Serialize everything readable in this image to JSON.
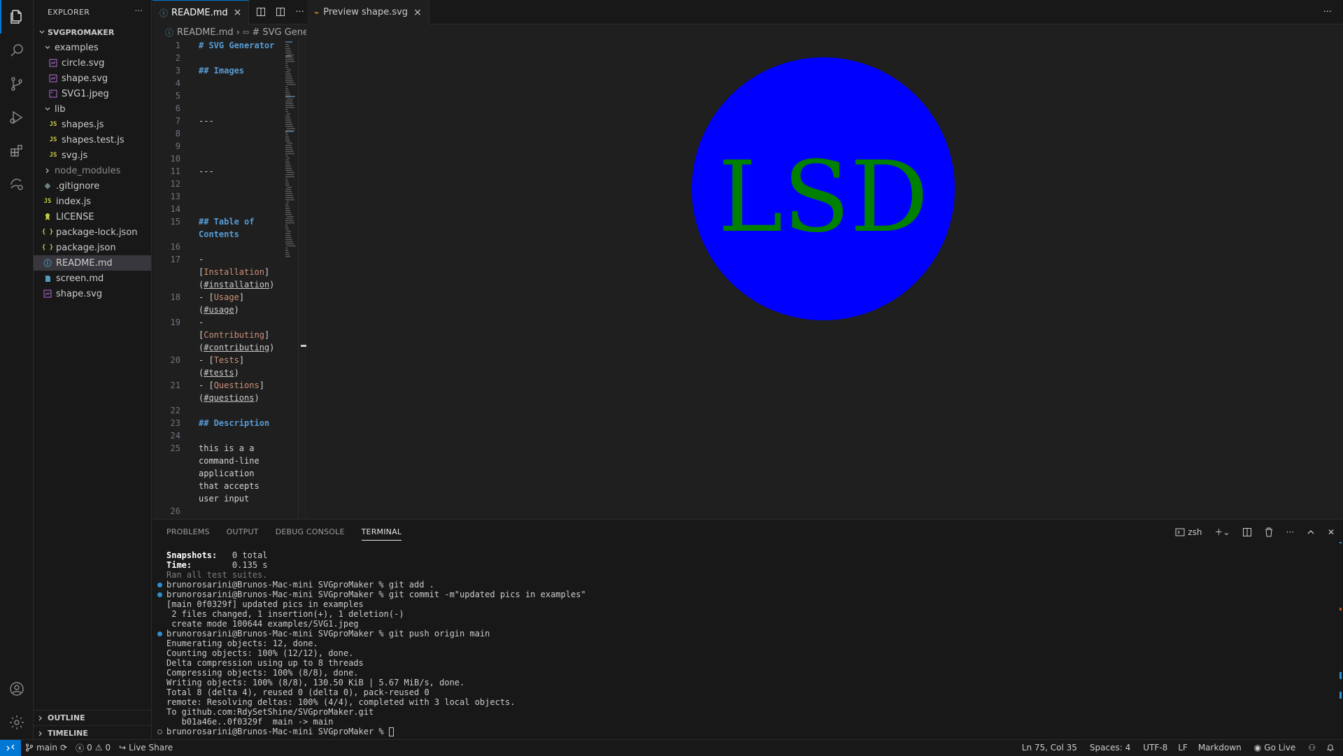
{
  "sidebar": {
    "title": "EXPLORER",
    "project": "SVGPROMAKER",
    "tree": [
      {
        "label": "examples",
        "type": "folder-open",
        "indent": 1
      },
      {
        "label": "circle.svg",
        "type": "svg",
        "indent": 2
      },
      {
        "label": "shape.svg",
        "type": "svg",
        "indent": 2
      },
      {
        "label": "SVG1.jpeg",
        "type": "image",
        "indent": 2
      },
      {
        "label": "lib",
        "type": "folder-open",
        "indent": 1
      },
      {
        "label": "shapes.js",
        "type": "js",
        "indent": 2
      },
      {
        "label": "shapes.test.js",
        "type": "js",
        "indent": 2
      },
      {
        "label": "svg.js",
        "type": "js",
        "indent": 2
      },
      {
        "label": "node_modules",
        "type": "folder-closed",
        "indent": 1
      },
      {
        "label": ".gitignore",
        "type": "git",
        "indent": 1
      },
      {
        "label": "index.js",
        "type": "js",
        "indent": 1
      },
      {
        "label": "LICENSE",
        "type": "license",
        "indent": 1
      },
      {
        "label": "package-lock.json",
        "type": "json",
        "indent": 1
      },
      {
        "label": "package.json",
        "type": "json",
        "indent": 1
      },
      {
        "label": "README.md",
        "type": "info",
        "indent": 1,
        "selected": true
      },
      {
        "label": "screen.md",
        "type": "md",
        "indent": 1
      },
      {
        "label": "shape.svg",
        "type": "svg",
        "indent": 1
      }
    ],
    "outline": "OUTLINE",
    "timeline": "TIMELINE"
  },
  "editor1": {
    "tab_label": "README.md",
    "breadcrumb_file": "README.md",
    "breadcrumb_symbol": "# SVG Gene",
    "lines": [
      {
        "n": "1",
        "segs": [
          {
            "t": "# SVG Generator",
            "c": "md-h"
          }
        ]
      },
      {
        "n": "2",
        "segs": []
      },
      {
        "n": "3",
        "segs": [
          {
            "t": "## Images",
            "c": "md-h"
          }
        ]
      },
      {
        "n": "4",
        "segs": []
      },
      {
        "n": "5",
        "segs": []
      },
      {
        "n": "6",
        "segs": []
      },
      {
        "n": "7",
        "segs": [
          {
            "t": "---",
            "c": "md-plain"
          }
        ]
      },
      {
        "n": "8",
        "segs": []
      },
      {
        "n": "9",
        "segs": []
      },
      {
        "n": "10",
        "segs": []
      },
      {
        "n": "11",
        "segs": [
          {
            "t": "---",
            "c": "md-plain"
          }
        ]
      },
      {
        "n": "12",
        "segs": []
      },
      {
        "n": "13",
        "segs": []
      },
      {
        "n": "14",
        "segs": []
      },
      {
        "n": "15",
        "segs": [
          {
            "t": "## Table of\nContents",
            "c": "md-h"
          }
        ]
      },
      {
        "n": "16",
        "segs": []
      },
      {
        "n": "17",
        "segs": [
          {
            "t": "-\n[",
            "c": "md-plain"
          },
          {
            "t": "Installation",
            "c": "md-link"
          },
          {
            "t": "]\n(",
            "c": "md-plain"
          },
          {
            "t": "#installation",
            "c": "md-url"
          },
          {
            "t": ")",
            "c": "md-plain"
          }
        ]
      },
      {
        "n": "18",
        "segs": [
          {
            "t": "- [",
            "c": "md-plain"
          },
          {
            "t": "Usage",
            "c": "md-link"
          },
          {
            "t": "]\n(",
            "c": "md-plain"
          },
          {
            "t": "#usage",
            "c": "md-url"
          },
          {
            "t": ")",
            "c": "md-plain"
          }
        ]
      },
      {
        "n": "19",
        "segs": [
          {
            "t": "-\n[",
            "c": "md-plain"
          },
          {
            "t": "Contributing",
            "c": "md-link"
          },
          {
            "t": "]\n(",
            "c": "md-plain"
          },
          {
            "t": "#contributing",
            "c": "md-url"
          },
          {
            "t": ")",
            "c": "md-plain"
          }
        ]
      },
      {
        "n": "20",
        "segs": [
          {
            "t": "- [",
            "c": "md-plain"
          },
          {
            "t": "Tests",
            "c": "md-link"
          },
          {
            "t": "]\n(",
            "c": "md-plain"
          },
          {
            "t": "#tests",
            "c": "md-url"
          },
          {
            "t": ")",
            "c": "md-plain"
          }
        ]
      },
      {
        "n": "21",
        "segs": [
          {
            "t": "- [",
            "c": "md-plain"
          },
          {
            "t": "Questions",
            "c": "md-link"
          },
          {
            "t": "]\n(",
            "c": "md-plain"
          },
          {
            "t": "#questions",
            "c": "md-url"
          },
          {
            "t": ")",
            "c": "md-plain"
          }
        ]
      },
      {
        "n": "22",
        "segs": []
      },
      {
        "n": "23",
        "segs": [
          {
            "t": "## Description",
            "c": "md-h"
          }
        ]
      },
      {
        "n": "24",
        "segs": []
      },
      {
        "n": "25",
        "segs": [
          {
            "t": "this is a a\ncommand-line\napplication\nthat accepts\nuser input",
            "c": "md-plain"
          }
        ]
      },
      {
        "n": "26",
        "segs": []
      }
    ]
  },
  "editor2": {
    "tab_label": "Preview shape.svg",
    "svg_text": "LSD",
    "circle_color": "#0000ff",
    "text_color": "#008000"
  },
  "panel": {
    "tabs": [
      "PROBLEMS",
      "OUTPUT",
      "DEBUG CONSOLE",
      "TERMINAL"
    ],
    "shell": "zsh",
    "terminal_lines": [
      {
        "text": "Snapshots:   0 total",
        "bold_prefix": "Snapshots:",
        "dot": ""
      },
      {
        "text": "Time:        0.135 s",
        "bold_prefix": "Time:",
        "dot": ""
      },
      {
        "text": "Ran all test suites.",
        "dim": true,
        "dot": ""
      },
      {
        "text": "brunorosarini@Brunos-Mac-mini SVGproMaker % git add .",
        "dot": "blue"
      },
      {
        "text": "brunorosarini@Brunos-Mac-mini SVGproMaker % git commit -m\"updated pics in examples\"",
        "dot": "blue"
      },
      {
        "text": "[main 0f0329f] updated pics in examples",
        "dot": ""
      },
      {
        "text": " 2 files changed, 1 insertion(+), 1 deletion(-)",
        "dot": ""
      },
      {
        "text": " create mode 100644 examples/SVG1.jpeg",
        "dot": ""
      },
      {
        "text": "brunorosarini@Brunos-Mac-mini SVGproMaker % git push origin main",
        "dot": "blue"
      },
      {
        "text": "Enumerating objects: 12, done.",
        "dot": ""
      },
      {
        "text": "Counting objects: 100% (12/12), done.",
        "dot": ""
      },
      {
        "text": "Delta compression using up to 8 threads",
        "dot": ""
      },
      {
        "text": "Compressing objects: 100% (8/8), done.",
        "dot": ""
      },
      {
        "text": "Writing objects: 100% (8/8), 130.50 KiB | 5.67 MiB/s, done.",
        "dot": ""
      },
      {
        "text": "Total 8 (delta 4), reused 0 (delta 0), pack-reused 0",
        "dot": ""
      },
      {
        "text": "remote: Resolving deltas: 100% (4/4), completed with 3 local objects.",
        "dot": ""
      },
      {
        "text": "To github.com:RdySetShine/SVGproMaker.git",
        "dot": ""
      },
      {
        "text": "   b01a46e..0f0329f  main -> main",
        "dot": ""
      },
      {
        "text": "brunorosarini@Brunos-Mac-mini SVGproMaker % ",
        "dot": "hollow",
        "cursor": true
      }
    ]
  },
  "statusbar": {
    "branch": "main",
    "errors": "0",
    "warnings": "0",
    "live_share": "Live Share",
    "cursor_pos": "Ln 75, Col 35",
    "spaces": "Spaces: 4",
    "encoding": "UTF-8",
    "eol": "LF",
    "language": "Markdown",
    "go_live": "Go Live"
  }
}
